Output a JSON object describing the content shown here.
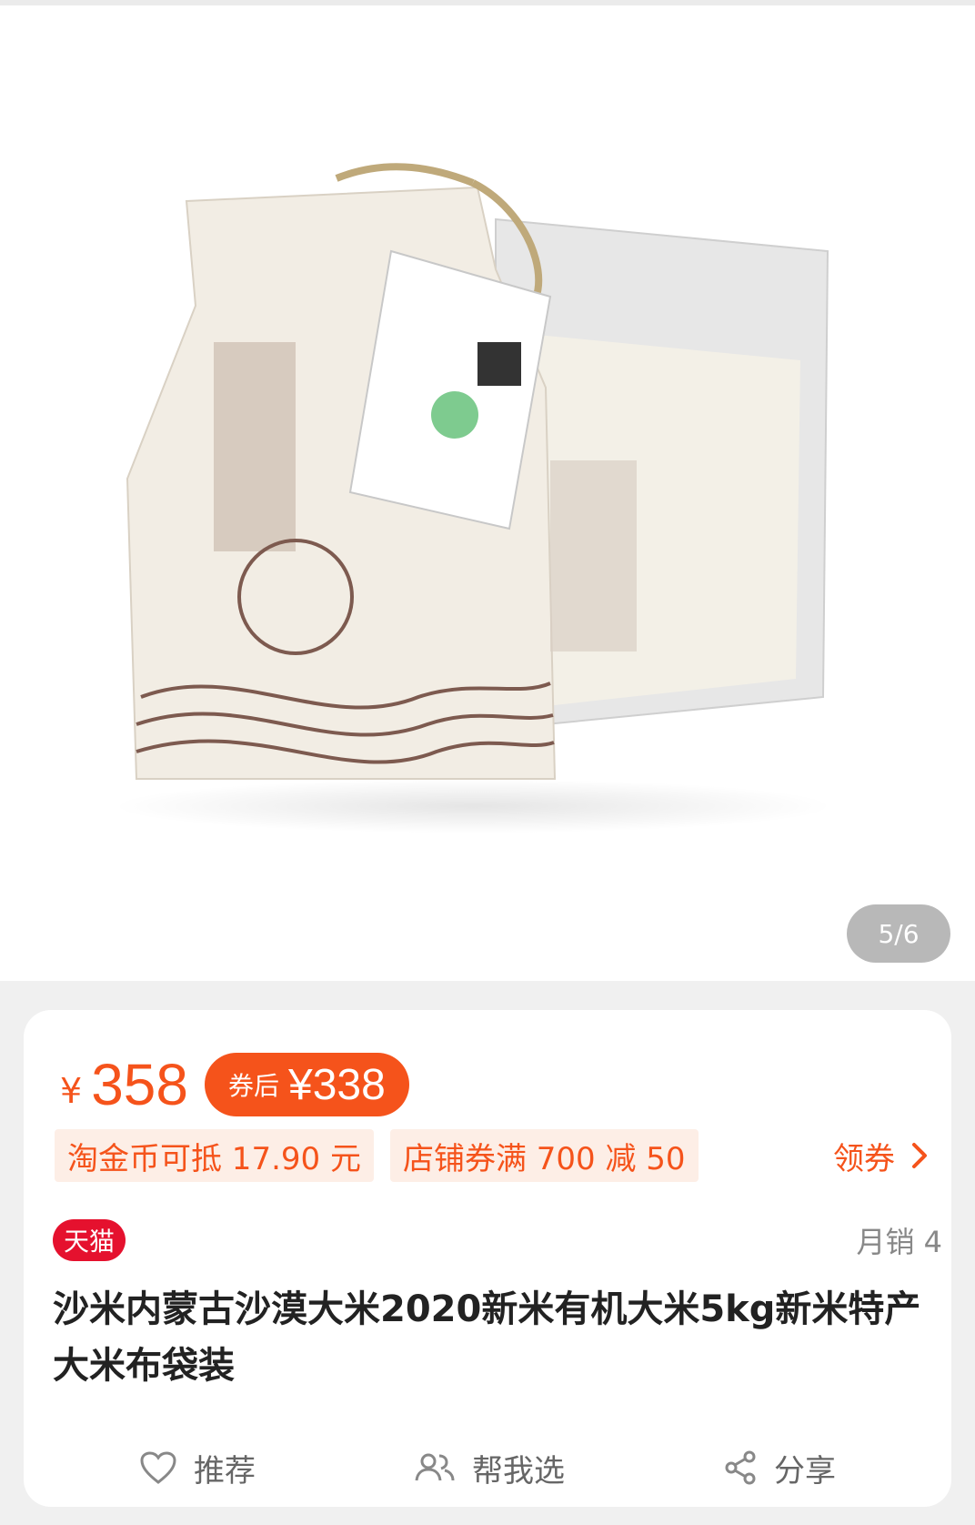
{
  "gallery": {
    "counter": "5/6",
    "image_alt": "product-photo"
  },
  "price": {
    "currency": "¥",
    "value": "358"
  },
  "coupon": {
    "label": "券后",
    "currency": "¥",
    "value": "338"
  },
  "promos": {
    "tag1": "淘金币可抵 17.90 元",
    "tag2": "店铺券满 700 减 50",
    "claim": "领券"
  },
  "meta": {
    "badge": "天猫",
    "sales": "月销 4"
  },
  "title": "沙米内蒙古沙漠大米2020新米有机大米5kg新米特产大米布袋装",
  "actions": {
    "recommend": "推荐",
    "help_choose": "帮我选",
    "share": "分享"
  },
  "colors": {
    "accent": "#f5531b",
    "tmall": "#e5112e"
  }
}
